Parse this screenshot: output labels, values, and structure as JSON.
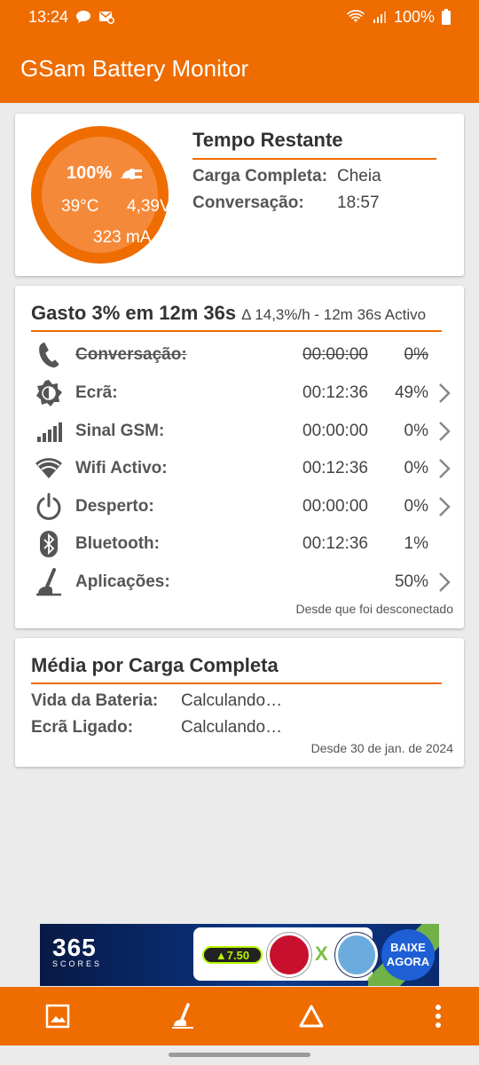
{
  "status_bar": {
    "time": "13:24",
    "battery_level": "100%"
  },
  "app": {
    "title": "GSam Battery Monitor"
  },
  "summary": {
    "battery_percent": "100%",
    "temperature": "39°C",
    "voltage": "4,39V",
    "current": "323 mA",
    "title": "Tempo Restante",
    "rows": [
      {
        "label": "Carga Completa:",
        "value": "Cheia"
      },
      {
        "label": "Conversação:",
        "value": "18:57"
      }
    ]
  },
  "usage": {
    "title": "Gasto 3% em 12m 36s",
    "subtitle": "Δ 14,3%/h - 12m 36s Activo",
    "rows": [
      {
        "label": "Conversação:",
        "time": "00:00:00",
        "pct": "0%",
        "icon": "phone-icon",
        "disabled": true,
        "chevron": false
      },
      {
        "label": "Ecrã:",
        "time": "00:12:36",
        "pct": "49%",
        "icon": "brightness-icon",
        "disabled": false,
        "chevron": true
      },
      {
        "label": "Sinal GSM:",
        "time": "00:00:00",
        "pct": "0%",
        "icon": "signal-icon",
        "disabled": false,
        "chevron": true
      },
      {
        "label": "Wifi Activo:",
        "time": "00:12:36",
        "pct": "0%",
        "icon": "wifi-icon",
        "disabled": false,
        "chevron": true
      },
      {
        "label": "Desperto:",
        "time": "00:00:00",
        "pct": "0%",
        "icon": "power-icon",
        "disabled": false,
        "chevron": true
      },
      {
        "label": "Bluetooth:",
        "time": "00:12:36",
        "pct": "1%",
        "icon": "bluetooth-icon",
        "disabled": false,
        "chevron": false
      },
      {
        "label": "Aplicações:",
        "time": "",
        "pct": "50%",
        "icon": "apps-icon",
        "disabled": false,
        "chevron": true
      }
    ],
    "footer": "Desde que foi desconectado"
  },
  "average": {
    "title": "Média por Carga Completa",
    "rows": [
      {
        "label": "Vida da Bateria:",
        "value": "Calculando…"
      },
      {
        "label": "Ecrã Ligado:",
        "value": "Calculando…"
      }
    ],
    "footer": "Desde 30 de jan. de 2024"
  },
  "ad": {
    "brand": "365",
    "brand_sub": "SCORES",
    "odds": "▲7.50",
    "versus": "X",
    "cta": "BAIXE AGORA"
  },
  "bottom_nav": [
    "image-icon",
    "apps-icon",
    "delta-icon",
    "more-vert-icon"
  ],
  "colors": {
    "accent": "#ef6c00",
    "gauge_inner": "#f5893a",
    "background": "#ebebeb"
  }
}
